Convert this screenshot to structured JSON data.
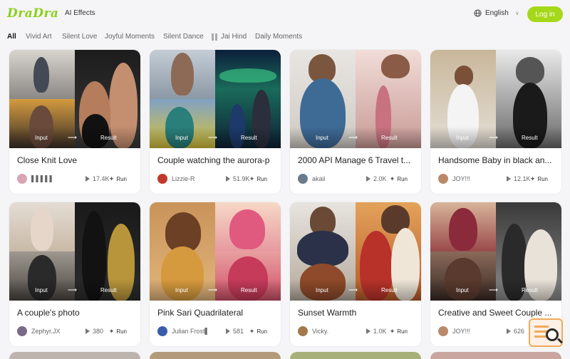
{
  "header": {
    "logo": "DraDra",
    "nav_link": "AI Effects",
    "language": "English",
    "login_label": "Log in"
  },
  "tabs": [
    {
      "label": "All",
      "active": true
    },
    {
      "label": "Vivid Art",
      "active": false
    },
    {
      "label": "Silent Love",
      "active": false
    },
    {
      "label": "Joyful Moments",
      "active": false
    },
    {
      "label": "Silent Dance",
      "active": false
    },
    {
      "label": "Jai Hind",
      "active": false,
      "icon": "pause-bars-icon"
    },
    {
      "label": "Daily Moments",
      "active": false
    }
  ],
  "thumb_labels": {
    "input": "Input",
    "result": "Result"
  },
  "run_label": "Run",
  "cards": [
    {
      "title": "Close Knit Love",
      "user": "▌▌▌▌▌",
      "views": "17.4K",
      "avatar_color": "#d9a5b3"
    },
    {
      "title": "Couple watching the aurora-p",
      "user": "Lizzie-R",
      "views": "51.9K",
      "avatar_color": "#c0392b"
    },
    {
      "title": "2000 API Manage 6 Travel t...",
      "user": "akaii",
      "views": "2.0K",
      "avatar_color": "#6b7b8c"
    },
    {
      "title": "Handsome Baby in black an...",
      "user": "JOY!!!",
      "views": "12.1K",
      "avatar_color": "#b98a6a"
    },
    {
      "title": "A couple's photo",
      "user": "Zephyr.JX",
      "views": "380",
      "avatar_color": "#7a6a8a"
    },
    {
      "title": "Pink Sari Quadrilateral",
      "user": "Julian Frost▌",
      "views": "581",
      "avatar_color": "#3b5bab"
    },
    {
      "title": "Sunset Warmth",
      "user": "Vicky.",
      "views": "1.0K",
      "avatar_color": "#a37a4e"
    },
    {
      "title": "Creative and Sweet Couple ...",
      "user": "JOY!!!",
      "views": "626",
      "avatar_color": "#b98a6a"
    }
  ],
  "colors": {
    "brand": "#8ccf1c",
    "login_bg": "#a6d81a",
    "page_bg": "#f5f5f7"
  }
}
